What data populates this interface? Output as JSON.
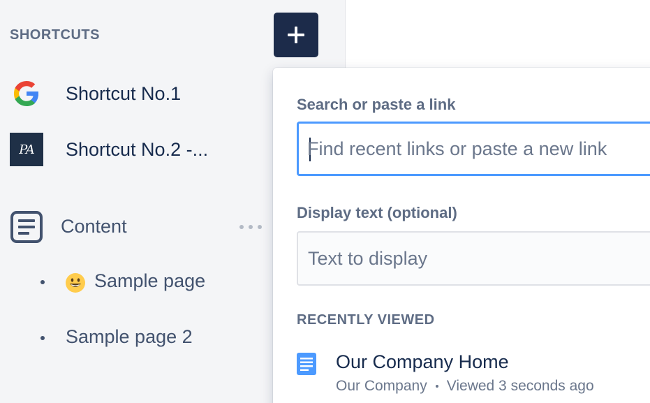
{
  "sidebar": {
    "section_title": "SHORTCUTS",
    "shortcuts": [
      {
        "label": "Shortcut No.1",
        "icon": "google-logo"
      },
      {
        "label": "Shortcut No.2 -...",
        "icon": "pa-logo",
        "logo_text": "PA"
      }
    ],
    "content": {
      "label": "Content",
      "icon": "document-icon",
      "more_icon": "more-icon"
    },
    "pages": [
      {
        "label": "Sample page",
        "emoji": "smiley-emoji"
      },
      {
        "label": "Sample page 2"
      }
    ]
  },
  "toolbar": {
    "add_icon": "plus-icon"
  },
  "link_popup": {
    "search_label": "Search or paste a link",
    "search_placeholder": "Find recent links or paste a new link",
    "search_value": "",
    "display_label": "Display text (optional)",
    "display_placeholder": "Text to display",
    "display_value": "",
    "recent_title": "RECENTLY VIEWED",
    "recent_items": [
      {
        "title": "Our Company Home",
        "space": "Our Company",
        "viewed": "Viewed 3 seconds ago",
        "icon": "page-icon"
      }
    ]
  },
  "colors": {
    "sidebar_bg": "#f4f5f7",
    "button_dark": "#1c2b4a",
    "focus_border": "#4c9aff",
    "text_primary": "#172b4d",
    "text_secondary": "#5e6c84"
  }
}
